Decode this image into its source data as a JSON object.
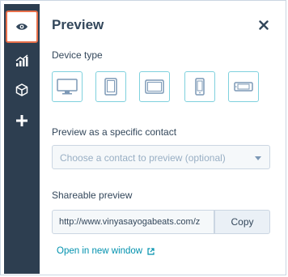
{
  "sidebar": {
    "items": [
      {
        "icon": "eye-icon",
        "active": true
      },
      {
        "icon": "chart-icon",
        "active": false
      },
      {
        "icon": "box-icon",
        "active": false
      },
      {
        "icon": "plus-icon",
        "active": false
      }
    ]
  },
  "panel": {
    "title": "Preview",
    "close_icon": "close-icon"
  },
  "device_type": {
    "label": "Device type",
    "devices": [
      "desktop-icon",
      "tablet-portrait-icon",
      "tablet-landscape-icon",
      "phone-portrait-icon",
      "phone-landscape-icon"
    ]
  },
  "contact": {
    "label": "Preview as a specific contact",
    "placeholder": "Choose a contact to preview (optional)"
  },
  "shareable": {
    "label": "Shareable preview",
    "url": "http://www.vinyasayogabeats.com/z",
    "copy_label": "Copy",
    "open_label": "Open in new window"
  },
  "colors": {
    "rail": "#2d3e50",
    "accent_border": "#e86f4a",
    "device_border": "#7fd1de",
    "link": "#0091ae"
  }
}
